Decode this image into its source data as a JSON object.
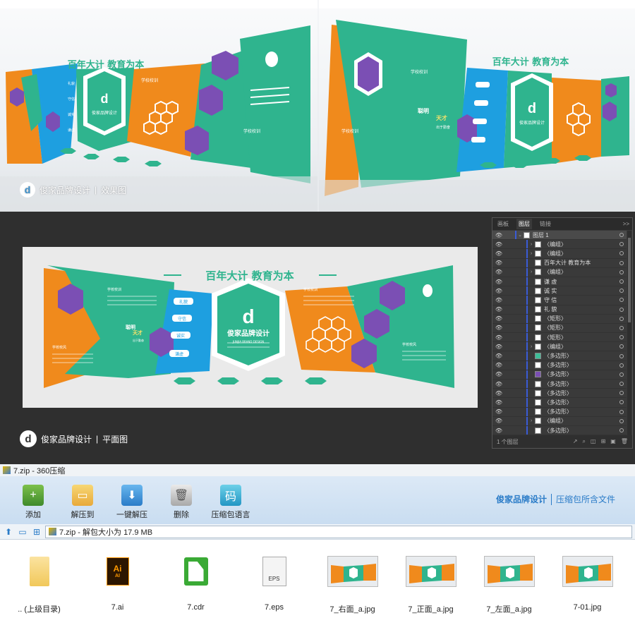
{
  "render": {
    "slogan": "百年大计 教育为本",
    "brand_small": "俊家品牌设计",
    "caption": "效果图",
    "caption_brand": "俊家品牌设计",
    "labels": [
      "学校校训",
      "学校校训",
      "学校校训"
    ],
    "tags": [
      "礼貌",
      "守信",
      "诚实",
      "谦虚"
    ],
    "vertical_text_a": "聪明",
    "vertical_text_b": "天才",
    "vertical_text_c": "出于勤奋"
  },
  "flat": {
    "slogan": "百年大计 教育为本",
    "brand_center": "俊家品牌设计",
    "brand_sub": "JUNJIA BRAND DESIGN",
    "tags": [
      "礼貌",
      "守信",
      "诚实",
      "谦虚"
    ],
    "labels": [
      "学校校训",
      "学校校风",
      "学校校训",
      "学校校风"
    ],
    "vertical_text_a": "聪明",
    "vertical_text_b": "天才",
    "vertical_text_c": "出于勤奋",
    "caption_brand": "俊家品牌设计",
    "caption": "平面图"
  },
  "layers_panel": {
    "tabs": [
      "画板",
      "图层",
      "链接"
    ],
    "active_tab": "图层",
    "more": ">>",
    "rows": [
      {
        "name": "图层 1",
        "arrow": "⌄",
        "top": true
      },
      {
        "name": "〈编组〉",
        "arrow": "›"
      },
      {
        "name": "〈编组〉",
        "arrow": "›"
      },
      {
        "name": "百年大计 教育为本",
        "arrow": ""
      },
      {
        "name": "〈编组〉",
        "arrow": "›"
      },
      {
        "name": "谦 虚",
        "arrow": ""
      },
      {
        "name": "诚 实",
        "arrow": ""
      },
      {
        "name": "守 信",
        "arrow": ""
      },
      {
        "name": "礼 貌",
        "arrow": ""
      },
      {
        "name": "〈矩形〉",
        "arrow": ""
      },
      {
        "name": "〈矩形〉",
        "arrow": ""
      },
      {
        "name": "〈矩形〉",
        "arrow": ""
      },
      {
        "name": "〈编组〉",
        "arrow": "›"
      },
      {
        "name": "〈多边形〉",
        "arrow": "",
        "thumb": "#3fbf9a"
      },
      {
        "name": "〈多边形〉",
        "arrow": ""
      },
      {
        "name": "〈多边形〉",
        "arrow": "",
        "thumb": "#7b4fb4"
      },
      {
        "name": "〈多边形〉",
        "arrow": ""
      },
      {
        "name": "〈多边形〉",
        "arrow": ""
      },
      {
        "name": "〈多边形〉",
        "arrow": ""
      },
      {
        "name": "〈多边形〉",
        "arrow": ""
      },
      {
        "name": "〈编组〉",
        "arrow": "›"
      },
      {
        "name": "〈多边形〉",
        "arrow": ""
      }
    ],
    "footer": "1 个图层"
  },
  "zip": {
    "window_title": "7.zip - 360压缩",
    "toolbar": [
      {
        "label": "添加",
        "cls": "add",
        "glyph": "+"
      },
      {
        "label": "解压到",
        "cls": "extract",
        "glyph": "▭"
      },
      {
        "label": "一键解压",
        "cls": "oneclick",
        "glyph": "⬇"
      },
      {
        "label": "删除",
        "cls": "delete",
        "glyph": "🗑"
      },
      {
        "label": "压缩包语言",
        "cls": "lang",
        "glyph": "码"
      }
    ],
    "brand_logo": "俊家品牌设计",
    "brand_text": "压缩包所含文件",
    "path_text": "7.zip - 解包大小为 17.9 MB",
    "files": [
      {
        "name": ".. (上级目录)",
        "type": "folder"
      },
      {
        "name": "7.ai",
        "type": "ai"
      },
      {
        "name": "7.cdr",
        "type": "cdr"
      },
      {
        "name": "7.eps",
        "type": "eps"
      },
      {
        "name": "7_右面_a.jpg",
        "type": "jpg"
      },
      {
        "name": "7_正面_a.jpg",
        "type": "jpg"
      },
      {
        "name": "7_左面_a.jpg",
        "type": "jpg"
      },
      {
        "name": "7-01.jpg",
        "type": "jpg"
      }
    ]
  },
  "colors": {
    "orange": "#f08a1c",
    "teal": "#2fb48e",
    "blue": "#1e9fe0",
    "purple": "#7b4fb4"
  }
}
